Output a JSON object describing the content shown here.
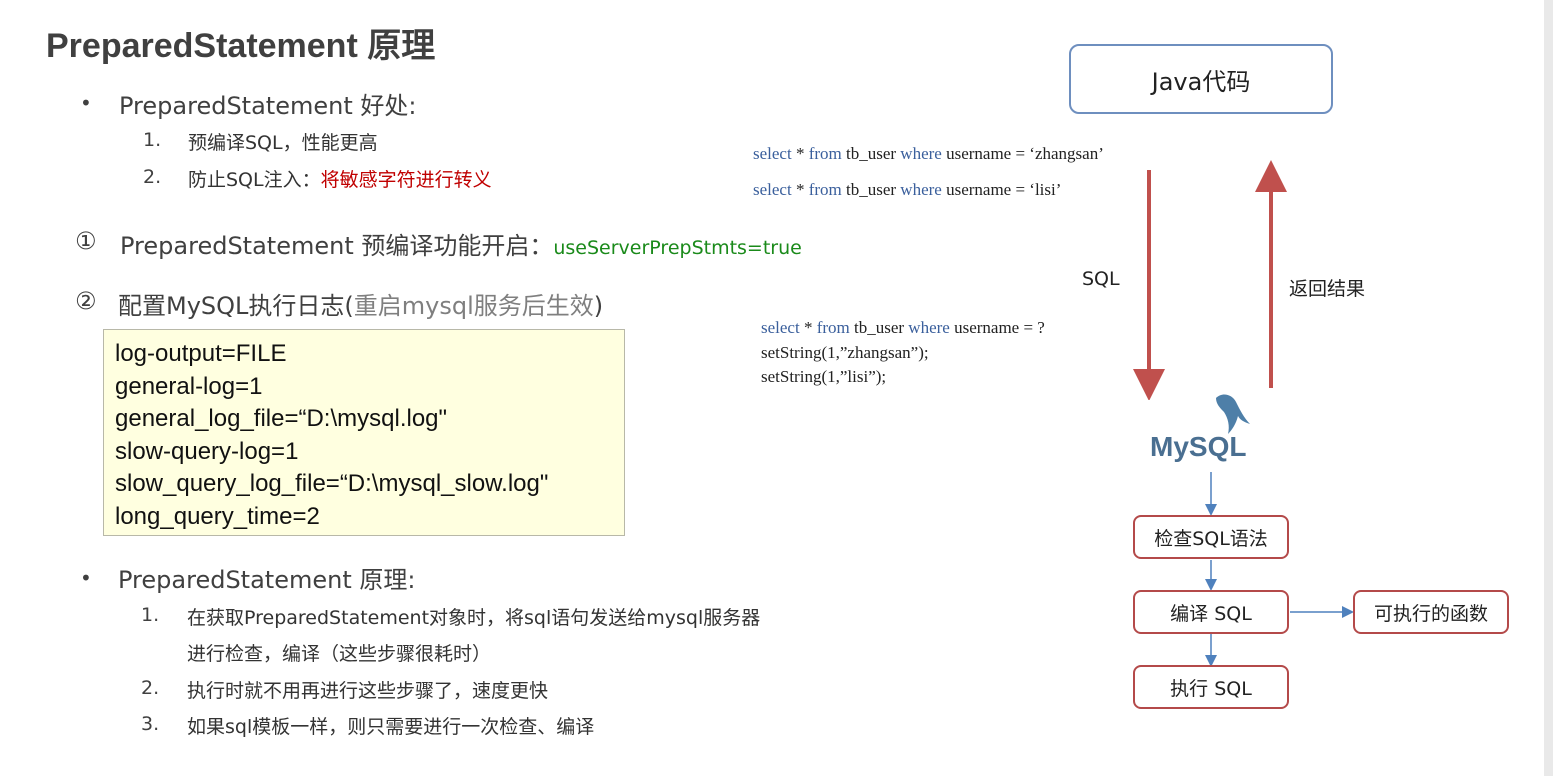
{
  "title": "PreparedStatement 原理",
  "benefits": {
    "heading": "PreparedStatement 好处:",
    "items": [
      {
        "num": "1.",
        "text": "预编译SQL，性能更高",
        "highlight": ""
      },
      {
        "num": "2.",
        "text": "防止SQL注入：",
        "highlight": "将敏感字符进行转义"
      }
    ]
  },
  "section1": {
    "marker": "①",
    "text": "PreparedStatement 预编译功能开启：",
    "code": "useServerPrepStmts=true"
  },
  "section2": {
    "marker": "②",
    "text": "配置MySQL执行日志(",
    "note": "重启mysql服务后生效",
    "close": ")"
  },
  "config_lines": [
    "log-output=FILE",
    "general-log=1",
    "general_log_file=“D:\\mysql.log\"",
    "slow-query-log=1",
    "slow_query_log_file=“D:\\mysql_slow.log\"",
    "long_query_time=2"
  ],
  "principle": {
    "heading": "PreparedStatement 原理:",
    "items": [
      {
        "num": "1.",
        "lines": [
          "在获取PreparedStatement对象时，将sql语句发送给mysql服务器",
          "进行检查，编译（这些步骤很耗时）"
        ]
      },
      {
        "num": "2.",
        "lines": [
          "执行时就不用再进行这些步骤了，速度更快"
        ]
      },
      {
        "num": "3.",
        "lines": [
          "如果sql模板一样，则只需要进行一次检查、编译"
        ]
      }
    ]
  },
  "diagram": {
    "java_box": "Java代码",
    "queries_top": [
      {
        "k1": "select",
        "a": " * ",
        "k2": "from",
        "b": " tb_user ",
        "k3": "where",
        "c": " username = ‘zhangsan’"
      },
      {
        "k1": "select",
        "a": " * ",
        "k2": "from",
        "b": " tb_user ",
        "k3": "where",
        "c": " username = ‘lisi’"
      }
    ],
    "sql_label": "SQL",
    "return_label": "返回结果",
    "prepared": {
      "query": {
        "k1": "select",
        "a": " * ",
        "k2": "from",
        "b": " tb_user ",
        "k3": "where",
        "c": " username = ?"
      },
      "set1": "setString(1,”zhangsan”);",
      "set2": "setString(1,”lisi”);"
    },
    "mysql_logo": "MySQL",
    "steps": [
      "检查SQL语法",
      "编译 SQL",
      "执行 SQL"
    ],
    "side_result": "可执行的函数",
    "colors": {
      "down_arrow": "#c0504d",
      "up_arrow": "#c0504d",
      "box_border": "#b44a4a",
      "java_border": "#6e8fbf",
      "flow_arrow": "#4f81bd"
    }
  }
}
